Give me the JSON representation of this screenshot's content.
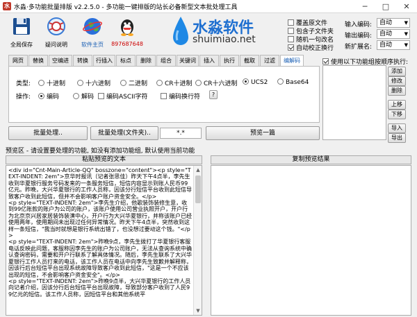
{
  "window": {
    "title": "水淼·多功能批量排版 v2.2.5.0 - 多功能一键排版的站长必备新型文本批处理工具",
    "minimize": "─",
    "maximize": "□",
    "close": "✕"
  },
  "toolbar": {
    "items": [
      {
        "label": "全局保存",
        "icon": "save-icon"
      },
      {
        "label": "疑问说明",
        "icon": "help-icon"
      },
      {
        "label": "软件主页",
        "icon": "globe-icon"
      },
      {
        "label": "897687648",
        "icon": "qq-icon"
      }
    ]
  },
  "logo": {
    "name": "水淼软件",
    "url": "shuimiao.net"
  },
  "options": {
    "overwrite": "覆盖原文件",
    "include_sub": "包含子文件夹",
    "random_order": "随机一句改名",
    "auto_fix": "自动校正换行"
  },
  "encoding": {
    "input_label": "输入编码:",
    "input_value": "自动",
    "output_label": "输出编码:",
    "output_value": "自动",
    "ext_label": "新扩展名:",
    "ext_value": "自动"
  },
  "tabs": [
    "网页",
    "替换",
    "空编进",
    "转换",
    "行插入",
    "标点",
    "删除",
    "组合",
    "关键词",
    "插入",
    "执行",
    "截取",
    "过滤",
    "编解码"
  ],
  "panel": {
    "type_label": "类型:",
    "types": [
      "十进制",
      "十六进制",
      "二进制",
      "CR十进制",
      "CR十六进制",
      "UCS2",
      "Base64"
    ],
    "op_label": "操作:",
    "ops": [
      "编码",
      "解码"
    ],
    "opt_ascii": "编码ASCII字符",
    "opt_newline": "编码换行符",
    "help": "?"
  },
  "sidepanel": {
    "use_order": "使用以下功能组按顺序执行:",
    "add": "添加",
    "edit": "修改",
    "delete": "删除",
    "up": "上移",
    "down": "下移",
    "import": "导入",
    "export": "导出"
  },
  "actions": {
    "batch": "批量处理..",
    "batch_file": "批量处理(文件夹)..",
    "pattern": "*.*",
    "preview": "预览一篇"
  },
  "preview": {
    "hint": "预览区 - 请设置要处理的功能, 如没有添加功能组, 默认使用当前功能",
    "paste_header": "粘贴预览的文本",
    "result_header": "复制预览结果",
    "text": "<div id=\"Cnt-Main-Article-QQ\" bosszone=\"content\"><p style=\"TEXT-INDENT: 2em\">京华时报讯（记者张思佳）昨天下午4点半，李先生收到华夏银行服务号码发来的一条服务短信，短信内容显示到账人民币99亿元。昨晚，大兴华夏银行的工作人员称，因该分行短信平台收到此短信导致客户收到此短信，但并不会影响客户账户资金安全。</p>\n<p style=\"TEXT-INDENT: 2em\">李先生介绍，他歌装饰装修生意，收到99亿账款的账户为公司的账户，该账户使用公司营业执照开户，开户行为北京京兴居家居装饰装潢中心，开户行为大兴华夏银行，并称该账户已经使用两年，使用期间未出现过任何异常情况。昨天下午4点半，突然收到这样一条短信，\"我当时就想是银行系统出错了，也没想过要动这个钱。\"</p>\n<p style=\"TEXT-INDENT: 2em\">昨晚9点，李先生拨打了华夏银行客服电话反映此问题，客服称因李先生的账户为公司账户，无法从查询系统中确认查询密码，需要和开户行联系了解具体情况。随后，李先生联系了大兴华夏银行工作人员打来的电话，该工作人员在电话中向李先生致歉并解释称，因该行后台短信平台出现系统故障导致客户收到此短信，\"这是一个不应该出现的短信，不会影响客户资金安全\"。</p>\n<p style=\"TEXT-INDENT: 2em\">昨晚9点半，大兴华夏银行的工作人员向记者介绍，因该分行后台短信平台出现故障，导致部分客户收到了人民99亿元的短信。该工作人员称，因短信平台和其他系统平"
  }
}
